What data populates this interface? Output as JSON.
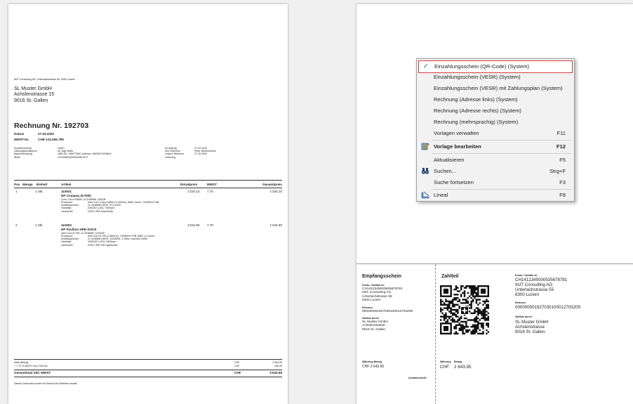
{
  "invoice": {
    "sender_line": "ItsIT Consulting AG, Unterlachstrasse 55, 6300 Luzern",
    "recipient": [
      "SL Muster GmbH",
      "Achslenstrasse 15",
      "9016 St. Gallen"
    ],
    "title": "Rechnung Nr. 192703",
    "datum_label": "Datum",
    "datum_value": "27.03.2020",
    "mwst_label": "MWST-Nr.",
    "mwst_value": "CHE-123.456.789",
    "meta_left_labels": [
      "Kundennummer",
      "Zahlungskonditionen",
      "Bankverbindung",
      "IBAN"
    ],
    "meta_left_values": [
      "10001",
      "30 Tage Netto",
      "UBS AG, SWIFT/BIC Adresse: UBSWCHZH80A",
      "CH1406500000003567871"
    ],
    "meta_right_labels": [
      "Ihr Auftrag",
      "Ihre Referenz",
      "Unsere Referenz",
      "Lieferung"
    ],
    "meta_right_values": [
      "27.03.2020",
      "",
      "Peter Breitenmoser",
      "27.03.2020"
    ],
    "table_headers": [
      "Pos",
      "Menge",
      "Einheit",
      "Artikel",
      "Einzelpreis",
      "MWST",
      "Gesamtpreis"
    ],
    "item1": {
      "pos": "1",
      "qty": "1 Stk.",
      "nr": "110001",
      "name": "HP Compaq dc7900",
      "desc": "Core 2 Duo E8500, 2x 2048MB, 250GB",
      "spec_labels": [
        "Prozessor:",
        "Arbeitsspeicher:",
        "Harddisk:",
        "Laufwerke:"
      ],
      "spec_values": [
        "Intel Core 2 Duo E8500 (3.16GHz), 6MB Cache, 1333MHz FSB",
        "2x 2048MB DDR2, PC2-6400",
        "250GB S-ATA, 7200rpm",
        "DVD+/-RW SuperMulti"
      ],
      "price": "1'220.10",
      "vat": "7.70",
      "total": "1'220.10"
    },
    "item2": {
      "pos": "2",
      "qty": "1 Stk.",
      "nr": "110052",
      "name": "HP Pavilion HPE-010ch",
      "desc": "Intel Core i5 750, 2x 2048MB, 1000GB",
      "spec_labels": [
        "Prozessor:",
        "Arbeitsspeicher:",
        "Harddisk:",
        "Laufwerke:"
      ],
      "spec_values": [
        "Intel Core i5 750 (2.66GHz), 1333MHz FSB, 8MB L2 Cache",
        "2x 2048MB DDR3, 1333MHz, 4 Slots, maximal 16GB",
        "1000GB S-ATA, 5400rpm",
        "DVD+/-RW SM Lightscribe"
      ],
      "price": "1'234.80",
      "vat": "7.70",
      "total": "1'234.80"
    },
    "netto_label": "Netto-Betrag",
    "netto_cur": "CHF",
    "netto_value": "2'454.90",
    "vat_line_label": "+ 7.70 % MWST von 2'454.90",
    "vat_line_cur": "CHF",
    "vat_line_value": "189.05",
    "total_label": "Gesamttotal inkl. MWST",
    "total_cur": "CHF",
    "total_value": "2'643.95",
    "footer": "Dieses Dokument wurde mit SelectLine Software erstellt"
  },
  "menu": {
    "items": [
      {
        "label": "Einzahlungsschein (QR-Code) (System)",
        "shortcut": "",
        "icon": "check-icon"
      },
      {
        "label": "Einzahlungsschein (VESR) (System)",
        "shortcut": "",
        "icon": ""
      },
      {
        "label": "Einzahlungsschein (VESR) mit Zahlungsplan (System)",
        "shortcut": "",
        "icon": ""
      },
      {
        "label": "Rechnung (Adresse links) (System)",
        "shortcut": "",
        "icon": ""
      },
      {
        "label": "Rechnung (Adresse rechts) (System)",
        "shortcut": "",
        "icon": ""
      },
      {
        "label": "Rechnung (mehrsprachig) (System)",
        "shortcut": "",
        "icon": ""
      },
      {
        "label": "Vorlagen verwalten",
        "shortcut": "F11",
        "icon": ""
      },
      {
        "label": "Vorlage bearbeiten",
        "shortcut": "F12",
        "icon": "edit-template-icon"
      },
      {
        "label": "Aktualisieren",
        "shortcut": "F5",
        "icon": ""
      },
      {
        "label": "Suchen...",
        "shortcut": "Strg+F",
        "icon": "binoculars-icon"
      },
      {
        "label": "Suche fortsetzen",
        "shortcut": "F3",
        "icon": ""
      },
      {
        "label": "Lineal",
        "shortcut": "F8",
        "icon": "ruler-icon"
      }
    ]
  },
  "slip": {
    "receipt_title": "Empfangsschein",
    "receipt_account_label": "Konto / Zahlbar an",
    "receipt_account": [
      "CH1412345000535678781",
      "ItsIT Consulting AG",
      "Unterlachstrasse 55",
      "6300 Luzern"
    ],
    "receipt_ref_label": "Referenz",
    "receipt_ref": "000000001927030100012703209",
    "receipt_payer_label": "Zahlbar durch",
    "receipt_payer": [
      "SL Muster GmbH",
      "Achslenstrasse",
      "9016 St. Gallen"
    ],
    "receipt_cur_label": "Währung Betrag",
    "receipt_amount": "CHF 2 643.95",
    "receipt_annahme": "Annahmestelle",
    "pay_title": "Zahlteil",
    "pay_account_label": "Konto / Zahlbar an",
    "pay_account": [
      "CH1412345000535678781",
      "ItsIT Consulting AG",
      "Unterlachstrasse 55",
      "6300 Luzern"
    ],
    "pay_ref_label": "Referenz",
    "pay_ref": "000000001927030100012703209",
    "pay_payer_label": "Zahlbar durch",
    "pay_payer": [
      "SL Muster GmbH",
      "Achslenstrasse",
      "9016 St. Gallen"
    ],
    "pay_cur_label": "Währung",
    "pay_amt_label": "Betrag",
    "pay_cur": "CHF",
    "pay_amount": "2 643.95"
  },
  "colors": {
    "highlight_border": "#d43c3c",
    "check": "#2a6fd6"
  }
}
